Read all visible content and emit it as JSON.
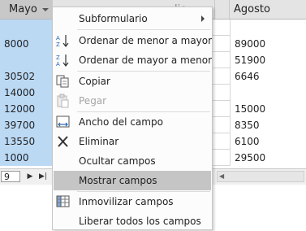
{
  "datasheet": {
    "columns": {
      "mayo": "Mayo",
      "hidden_tail": "lio",
      "agosto": "Agosto"
    },
    "rows": [
      {
        "mayo": "",
        "agosto": ""
      },
      {
        "mayo": "8000",
        "agosto": "89000"
      },
      {
        "mayo": "",
        "agosto": "51900"
      },
      {
        "mayo": "30502",
        "agosto": "6646"
      },
      {
        "mayo": "14000",
        "agosto": ""
      },
      {
        "mayo": "12000",
        "agosto": "15000"
      },
      {
        "mayo": "39700",
        "agosto": "8350"
      },
      {
        "mayo": "13550",
        "agosto": "6100"
      },
      {
        "mayo": "1000",
        "agosto": "29500"
      }
    ],
    "record_nav": {
      "current": "9",
      "next_icon": "▶",
      "last_icon": "▶|"
    }
  },
  "context_menu": {
    "items": [
      {
        "label": "Subformulario",
        "icon": "none",
        "submenu": true
      },
      {
        "label": "Ordenar de menor a mayor",
        "icon": "sort-ascending-icon"
      },
      {
        "label": "Ordenar de mayor a menor",
        "icon": "sort-descending-icon"
      },
      {
        "label": "Copiar",
        "icon": "copy-icon"
      },
      {
        "label": "Pegar",
        "icon": "paste-icon",
        "disabled": true
      },
      {
        "label": "Ancho del campo",
        "icon": "column-width-icon"
      },
      {
        "label": "Eliminar",
        "icon": "delete-icon"
      },
      {
        "label": "Ocultar campos",
        "icon": "none"
      },
      {
        "label": "Mostrar campos",
        "icon": "none",
        "highlighted": true
      },
      {
        "label": "Inmovilizar campos",
        "icon": "freeze-fields-icon"
      },
      {
        "label": "Liberar todos los campos",
        "icon": "none"
      }
    ]
  },
  "colors": {
    "selected_column": "#bcd9f4",
    "menu_highlight": "#c5c5c5",
    "menu_background": "#fcfcfc"
  }
}
